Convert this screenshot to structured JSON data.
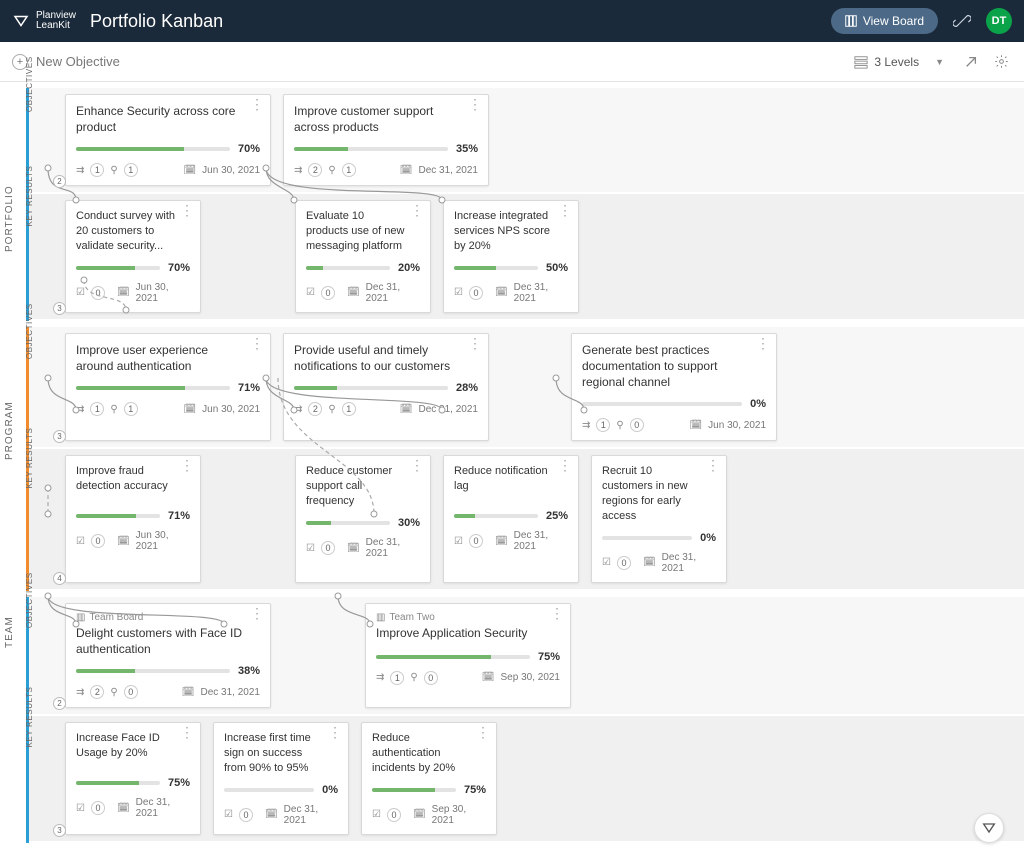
{
  "header": {
    "product_line1": "Planview",
    "product_line2": "LeanKit",
    "title": "Portfolio Kanban",
    "view_board": "View Board",
    "avatar": "DT"
  },
  "toolbar": {
    "new_objective": "New Objective",
    "levels": "3 Levels"
  },
  "lanes": {
    "portfolio": "PORTFOLIO",
    "program": "PROGRAM",
    "team": "TEAM",
    "objectives": "OBJECTIVES",
    "key_results": "KEY RESULTS"
  },
  "counts": {
    "port_obj": "2",
    "port_kr": "3",
    "prog_obj": "3",
    "prog_kr": "4",
    "team_obj": "2",
    "team_kr": "3"
  },
  "portfolio_obj": [
    {
      "title": "Enhance Security across core product",
      "pct": "70%",
      "p": 70,
      "date": "Jun 30, 2021",
      "sc": "1",
      "ac": "1"
    },
    {
      "title": "Improve customer support across products",
      "pct": "35%",
      "p": 35,
      "date": "Dec 31, 2021",
      "sc": "2",
      "ac": "1"
    }
  ],
  "portfolio_kr": [
    {
      "title": "Conduct survey with 20 customers to validate security...",
      "pct": "70%",
      "p": 70,
      "date": "Jun 30, 2021",
      "cc": "0"
    },
    {
      "title": "Evaluate 10 products use of new messaging platform",
      "pct": "20%",
      "p": 20,
      "date": "Dec 31, 2021",
      "cc": "0"
    },
    {
      "title": "Increase integrated services NPS score by 20%",
      "pct": "50%",
      "p": 50,
      "date": "Dec 31, 2021",
      "cc": "0"
    }
  ],
  "program_obj": [
    {
      "title": "Improve user experience around authentication",
      "pct": "71%",
      "p": 71,
      "date": "Jun 30, 2021",
      "sc": "1",
      "ac": "1"
    },
    {
      "title": "Provide useful and timely notifications to our customers",
      "pct": "28%",
      "p": 28,
      "date": "Dec 31, 2021",
      "sc": "2",
      "ac": "1"
    },
    {
      "title": "Generate best practices documentation to support regional channel",
      "pct": "0%",
      "p": 0,
      "date": "Jun 30, 2021",
      "sc": "1",
      "ac": "0"
    }
  ],
  "program_kr": [
    {
      "title": "Improve fraud detection accuracy",
      "pct": "71%",
      "p": 71,
      "date": "Jun 30, 2021",
      "cc": "0"
    },
    {
      "title": "Reduce customer support call frequency",
      "pct": "30%",
      "p": 30,
      "date": "Dec 31, 2021",
      "cc": "0"
    },
    {
      "title": "Reduce notification lag",
      "pct": "25%",
      "p": 25,
      "date": "Dec 31, 2021",
      "cc": "0"
    },
    {
      "title": "Recruit 10 customers in new regions for early access",
      "pct": "0%",
      "p": 0,
      "date": "Dec 31, 2021",
      "cc": "0"
    }
  ],
  "team_obj": [
    {
      "board": "Team Board",
      "title": "Delight customers with Face ID authentication",
      "pct": "38%",
      "p": 38,
      "date": "Dec 31, 2021",
      "sc": "2",
      "ac": "0"
    },
    {
      "board": "Team Two",
      "title": "Improve Application Security",
      "pct": "75%",
      "p": 75,
      "date": "Sep 30, 2021",
      "sc": "1",
      "ac": "0"
    }
  ],
  "team_kr": [
    {
      "title": "Increase Face ID Usage by 20%",
      "pct": "75%",
      "p": 75,
      "date": "Dec 31, 2021",
      "cc": "0"
    },
    {
      "title": "Increase first time sign on success from 90% to 95%",
      "pct": "0%",
      "p": 0,
      "date": "Dec 31, 2021",
      "cc": "0"
    },
    {
      "title": "Reduce authentication incidents by 20%",
      "pct": "75%",
      "p": 75,
      "date": "Sep 30, 2021",
      "cc": "0"
    }
  ]
}
